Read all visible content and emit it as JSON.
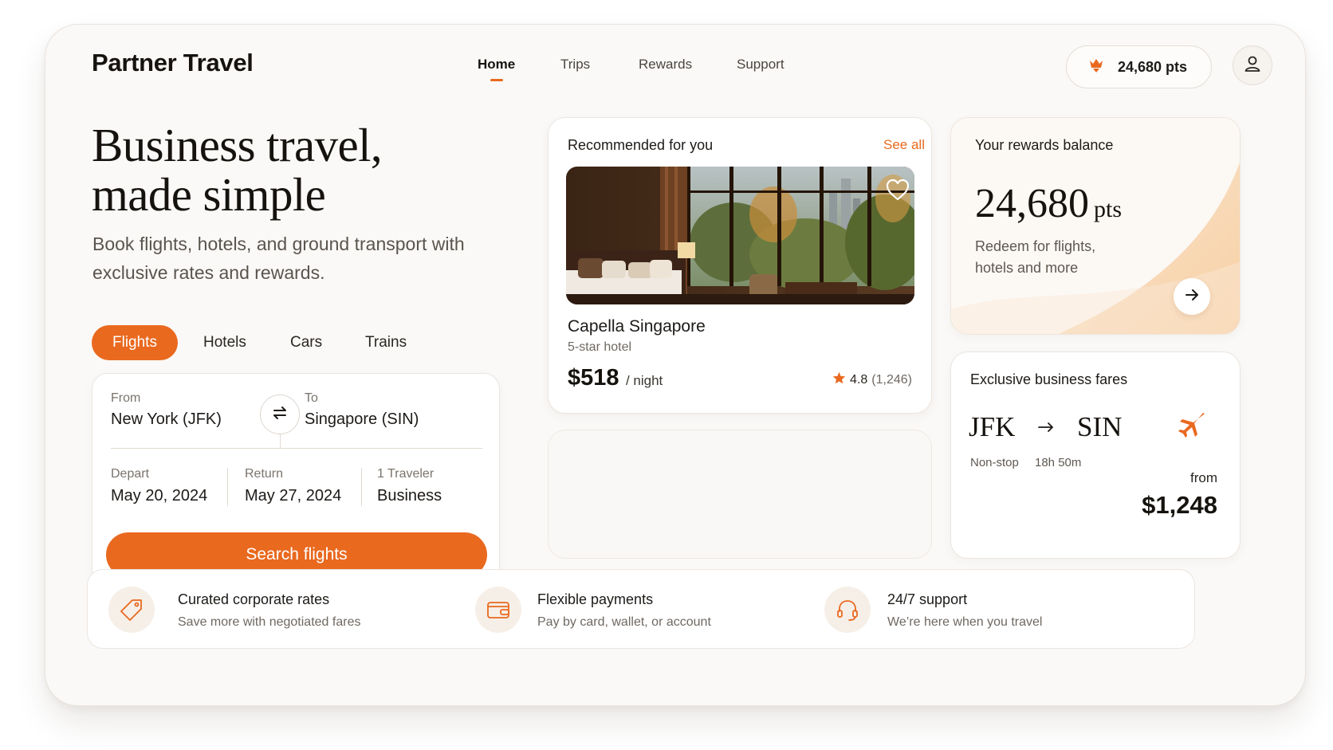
{
  "brand": "Partner Travel",
  "nav": [
    {
      "label": "Home",
      "active": true
    },
    {
      "label": "Trips",
      "active": false
    },
    {
      "label": "Rewards",
      "active": false
    },
    {
      "label": "Support",
      "active": false
    }
  ],
  "header": {
    "points_label": "24,680 pts",
    "points_icon": "rewards-crown-icon",
    "profile_icon": "user-icon"
  },
  "hero": {
    "title_line1": "Business travel,",
    "title_line2": "made simple",
    "subtitle": "Book flights, hotels, and ground transport with exclusive rates and rewards."
  },
  "tabs": [
    {
      "label": "Flights",
      "active": true
    },
    {
      "label": "Hotels",
      "active": false
    },
    {
      "label": "Cars",
      "active": false
    },
    {
      "label": "Trains",
      "active": false
    }
  ],
  "search": {
    "from_label": "From",
    "from_value": "New York (JFK)",
    "to_label": "To",
    "to_value": "Singapore (SIN)",
    "depart_label": "Depart",
    "depart_value": "May 20, 2024",
    "return_label": "Return",
    "return_value": "May 27, 2024",
    "travelers_label": "1 Traveler",
    "class_value": "Business",
    "button_label": "Search flights",
    "swap_icon": "swap-arrows-icon"
  },
  "recommended": {
    "title": "Recommended for you",
    "see_all": "See all",
    "hotel_name": "Capella Singapore",
    "hotel_type": "5-star hotel",
    "price": "$518",
    "price_unit": "/ night",
    "rating": "4.8",
    "reviews": "(1,246)"
  },
  "rewards": {
    "title": "Your rewards balance",
    "points": "24,680",
    "unit": "pts",
    "subtitle": "Redeem for flights, hotels and more"
  },
  "fares": {
    "title": "Exclusive business fares",
    "origin": "JFK",
    "destination": "SIN",
    "stops": "Non-stop",
    "duration": "18h 50m",
    "from_label": "from",
    "price": "$1,248"
  },
  "features": [
    {
      "icon": "price-tag-icon",
      "title": "Curated corporate rates",
      "subtitle": "Save more with negotiated fares"
    },
    {
      "icon": "wallet-icon",
      "title": "Flexible payments",
      "subtitle": "Pay by card, wallet, or account"
    },
    {
      "icon": "headset-icon",
      "title": "24/7 support",
      "subtitle": "We’re here when you travel"
    }
  ],
  "colors": {
    "accent": "#e9691f",
    "background": "#fbf9f7",
    "text": "#1d1a17"
  }
}
